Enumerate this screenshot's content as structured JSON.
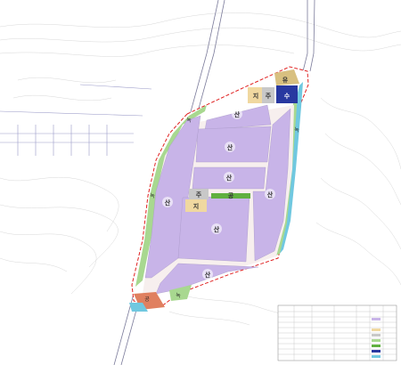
{
  "map": {
    "labels": {
      "industrial_a": "산",
      "industrial_b": "산",
      "industrial_c": "산",
      "industrial_d": "산",
      "industrial_e": "산",
      "industrial_f": "산",
      "support_a": "지",
      "support_b": "지",
      "parking_a": "주",
      "parking_b": "주",
      "utility": "유",
      "water": "수",
      "green_top": "녹",
      "green_mid": "공",
      "green_bottom": "녹",
      "green_right": "녹",
      "green_left": "녹",
      "public": "공"
    },
    "colors": {
      "industrial": "#c8b4e8",
      "support": "#f0d8a0",
      "parking": "#c8c8c8",
      "utility": "#d8c080",
      "water": "#2838a0",
      "green": "#a8d890",
      "park_green": "#60b040",
      "buffer": "#70c8e0",
      "road": "#f7efee",
      "boundary": "#e02020",
      "public": "#e08060"
    }
  }
}
